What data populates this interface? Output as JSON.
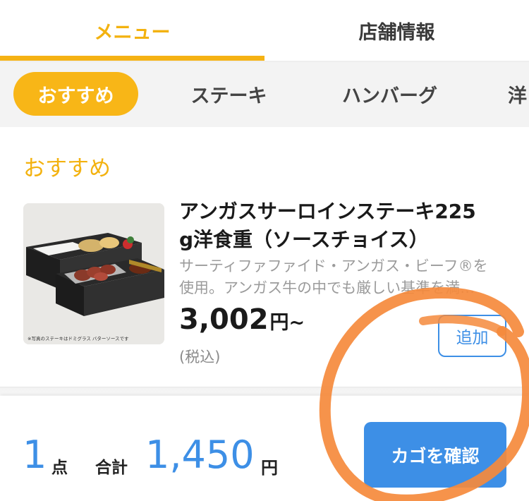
{
  "tabs": [
    {
      "label": "メニュー",
      "active": true
    },
    {
      "label": "店舗情報",
      "active": false
    }
  ],
  "categories": [
    {
      "label": "おすすめ",
      "active": true
    },
    {
      "label": "ステーキ"
    },
    {
      "label": "ハンバーグ"
    },
    {
      "label": "洋"
    }
  ],
  "section": {
    "title": "おすすめ"
  },
  "item": {
    "name_line1": "アンガスサーロインステーキ225",
    "name_line2": "g洋食重（ソースチョイス）",
    "desc_line1": "サーティファファイド・アンガス・ビーフ®を",
    "desc_line2": "使用。アンガス牛の中でも厳しい基準を満…",
    "price": "3,002",
    "price_unit": "円~",
    "tax_note": "(税込)",
    "image_caption": "※写真のステーキはドミグラス バターソースです",
    "add_label": "追加"
  },
  "footer": {
    "count": "1",
    "count_unit": "点",
    "total_label": "合計",
    "total_value": "1,450",
    "total_unit": "円",
    "cart_button": "カゴを確認"
  },
  "colors": {
    "accent_yellow": "#f5b214",
    "accent_blue": "#3d8fe6",
    "annotation_orange": "#f58a3c"
  }
}
